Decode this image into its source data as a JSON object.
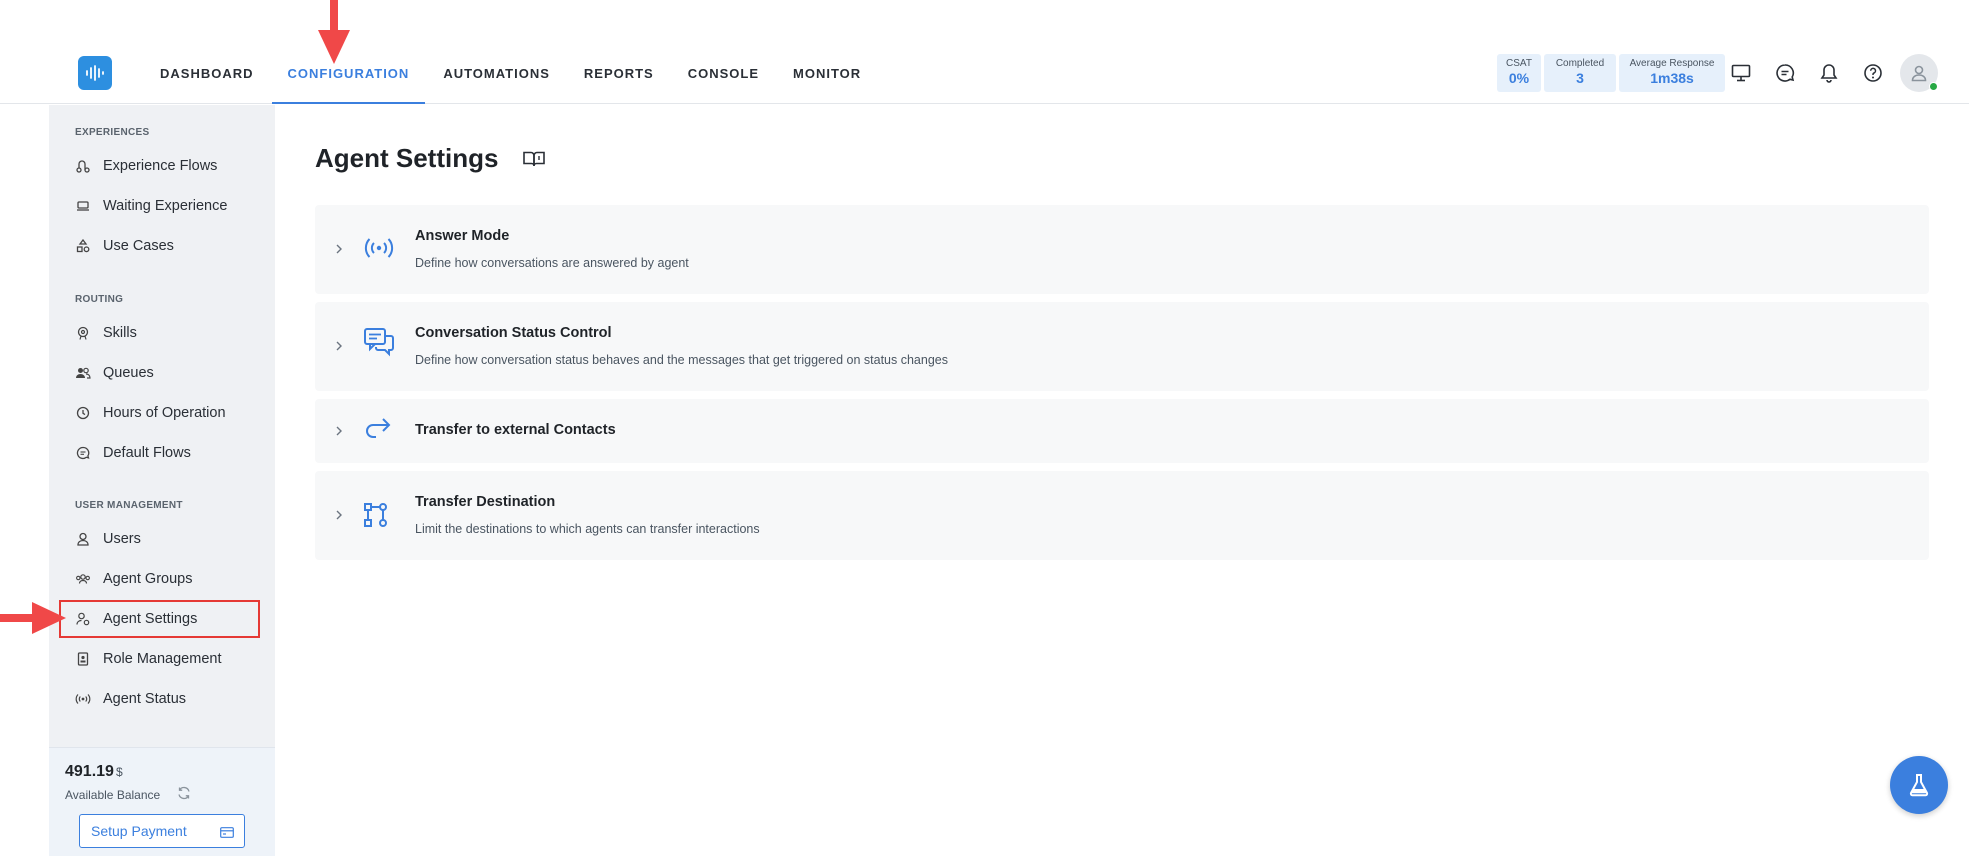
{
  "nav": {
    "items": [
      {
        "label": "DASHBOARD"
      },
      {
        "label": "CONFIGURATION"
      },
      {
        "label": "AUTOMATIONS"
      },
      {
        "label": "REPORTS"
      },
      {
        "label": "CONSOLE"
      },
      {
        "label": "MONITOR"
      }
    ],
    "active": "CONFIGURATION"
  },
  "stats": {
    "csat": {
      "label": "CSAT",
      "value": "0%"
    },
    "completed": {
      "label": "Completed",
      "value": "3"
    },
    "avg_response": {
      "label": "Average Response",
      "value": "1m38s"
    }
  },
  "top_icons": [
    "monitor-icon",
    "chat-icon",
    "bell-icon",
    "help-icon",
    "user-icon"
  ],
  "sidebar": {
    "sections": [
      {
        "title": "EXPERIENCES",
        "items": [
          {
            "label": "Experience Flows",
            "icon": "flow-icon"
          },
          {
            "label": "Waiting Experience",
            "icon": "couch-icon"
          },
          {
            "label": "Use Cases",
            "icon": "shapes-icon"
          }
        ]
      },
      {
        "title": "ROUTING",
        "items": [
          {
            "label": "Skills",
            "icon": "badge-icon"
          },
          {
            "label": "Queues",
            "icon": "people-icon"
          },
          {
            "label": "Hours of Operation",
            "icon": "clock-icon"
          },
          {
            "label": "Default Flows",
            "icon": "chat-bubble-icon"
          }
        ]
      },
      {
        "title": "USER MANAGEMENT",
        "items": [
          {
            "label": "Users",
            "icon": "users-icon"
          },
          {
            "label": "Agent Groups",
            "icon": "group-icon"
          },
          {
            "label": "Agent Settings",
            "icon": "user-gear-icon"
          },
          {
            "label": "Role Management",
            "icon": "id-badge-icon"
          },
          {
            "label": "Agent Status",
            "icon": "broadcast-icon"
          }
        ]
      }
    ],
    "selected": "Agent Settings"
  },
  "balance": {
    "value": "491.19",
    "currency": "$",
    "label": "Available Balance",
    "setup_label": "Setup Payment"
  },
  "page": {
    "title": "Agent Settings",
    "panels": [
      {
        "title": "Answer Mode",
        "description": "Define how conversations are answered by agent",
        "icon": "broadcast-icon"
      },
      {
        "title": "Conversation Status Control",
        "description": "Define how conversation status behaves and the messages that get triggered on status changes",
        "icon": "conversation-icon"
      },
      {
        "title": "Transfer to external Contacts",
        "description": "",
        "icon": "forward-arrow-icon"
      },
      {
        "title": "Transfer Destination",
        "description": "Limit the destinations to which agents can transfer interactions",
        "icon": "route-icon"
      }
    ]
  },
  "colors": {
    "accent": "#3b7fde",
    "highlight": "#e53935",
    "sidebar_bg": "#eff1f4",
    "panel_bg": "#f7f8f9"
  }
}
